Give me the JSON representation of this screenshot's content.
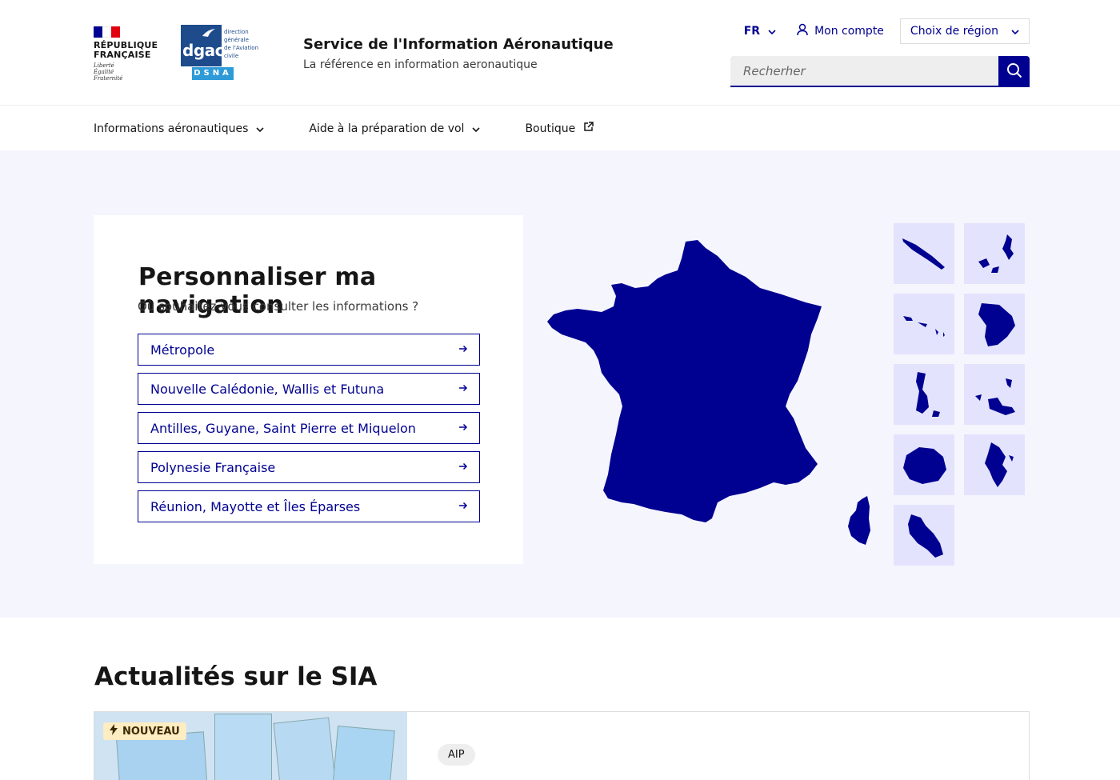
{
  "header": {
    "republic_line1": "RÉPUBLIQUE",
    "republic_line2": "FRANÇAISE",
    "motto": [
      "Liberté",
      "Égalité",
      "Fraternité"
    ],
    "dgac_word": "dgac",
    "dgac_side": [
      "direction",
      "générale",
      "de l'Aviation",
      "civile"
    ],
    "dgac_dsna": "DSNA",
    "site_title": "Service de l'Information Aéronautique",
    "site_tagline": "La référence en information aeronautique",
    "lang": "FR",
    "account_label": "Mon compte",
    "region_button": "Choix de région",
    "search_placeholder": "Recherher"
  },
  "nav": {
    "items": [
      "Informations aéronautiques",
      "Aide à la préparation de vol",
      "Boutique"
    ]
  },
  "hero": {
    "title": "Personnaliser ma navigation",
    "subtitle": "Où souhaitez-vous consulter les informations ?",
    "regions": [
      "Métropole",
      "Nouvelle Calédonie, Wallis et Futuna",
      "Antilles, Guyane, Saint Pierre et Miquelon",
      "Polynesie Française",
      "Réunion, Mayotte et Îles Éparses"
    ]
  },
  "news": {
    "title": "Actualités sur le SIA",
    "badge": "NOUVEAU",
    "tag": "AIP"
  },
  "colors": {
    "primary": "#000091",
    "hero_bg": "#f5f5fe",
    "thumb_bg": "#e3e3fd",
    "flag_blue": "#000091",
    "flag_red": "#e1000f"
  }
}
